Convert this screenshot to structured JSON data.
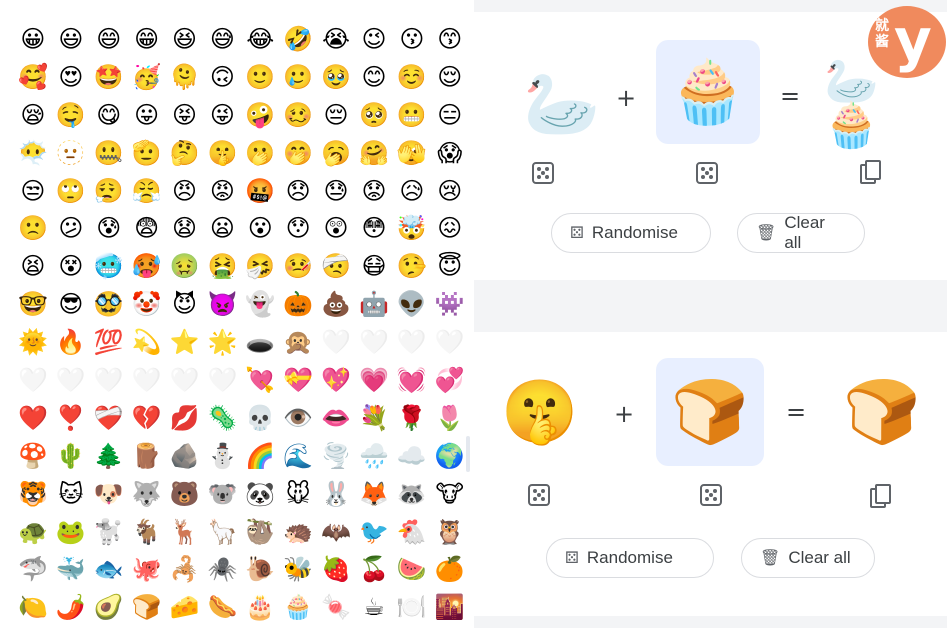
{
  "emoji_grid": [
    [
      "😀",
      "😃",
      "😄",
      "😁",
      "😆",
      "😅",
      "😂",
      "🤣",
      "😭",
      "😉",
      "😗",
      "😙"
    ],
    [
      "🥰",
      "😍",
      "🤩",
      "🥳",
      "🫠",
      "🙃",
      "🙂",
      "🥲",
      "🥹",
      "😊",
      "☺️",
      "😌"
    ],
    [
      "😪",
      "🤤",
      "😋",
      "😛",
      "😝",
      "😜",
      "🤪",
      "🥴",
      "😔",
      "🥺",
      "😬",
      "😑"
    ],
    [
      "😶‍🌫️",
      "🫥",
      "🤐",
      "🫡",
      "🤔",
      "🤫",
      "🫢",
      "🤭",
      "🥱",
      "🤗",
      "🫣",
      "😱"
    ],
    [
      "😒",
      "🙄",
      "😮‍💨",
      "😤",
      "😠",
      "😡",
      "🤬",
      "😞",
      "😓",
      "😟",
      "😥",
      "😢"
    ],
    [
      "🙁",
      "😕",
      "😰",
      "😨",
      "😧",
      "😦",
      "😮",
      "😯",
      "😲",
      "😳",
      "🤯",
      "😖"
    ],
    [
      "😫",
      "😵",
      "🥶",
      "🥵",
      "🤢",
      "🤮",
      "🤧",
      "🤒",
      "🤕",
      "😷",
      "🤥",
      "😇"
    ],
    [
      "🤓",
      "😎",
      "🥸",
      "🤡",
      "😈",
      "👿",
      "👻",
      "🎃",
      "💩",
      "🤖",
      "👽",
      "👾"
    ],
    [
      "🌞",
      "🔥",
      "💯",
      "💫",
      "⭐",
      "🌟",
      "🕳️",
      "🙊",
      "🤍",
      "🤍",
      "🤍",
      "🤍"
    ],
    [
      "🤍",
      "🤍",
      "🤍",
      "🤍",
      "🤍",
      "🤍",
      "💘",
      "💝",
      "💖",
      "💗",
      "💓",
      "💞"
    ],
    [
      "❤️",
      "❣️",
      "❤️‍🩹",
      "💔",
      "💋",
      "🦠",
      "💀",
      "👁️",
      "👄",
      "💐",
      "🌹",
      "🌷"
    ],
    [
      "🍄",
      "🌵",
      "🌲",
      "🪵",
      "🪨",
      "⛄",
      "🌈",
      "🌊",
      "🌪️",
      "🌧️",
      "☁️",
      "🌍"
    ],
    [
      "🐯",
      "🐱",
      "🐶",
      "🐺",
      "🐻",
      "🐨",
      "🐼",
      "🐭",
      "🐰",
      "🦊",
      "🦝",
      "🐮"
    ],
    [
      "🐢",
      "🐸",
      "🐩",
      "🐐",
      "🦌",
      "🦙",
      "🦥",
      "🦔",
      "🦇",
      "🐦",
      "🐔",
      "🦉"
    ],
    [
      "🦈",
      "🐳",
      "🐟",
      "🐙",
      "🦂",
      "🕷️",
      "🐌",
      "🐝",
      "🍓",
      "🍒",
      "🍉",
      "🍊"
    ],
    [
      "🍋",
      "🌶️",
      "🥑",
      "🍞",
      "🧀",
      "🌭",
      "🎂",
      "🧁",
      "🍬",
      "☕",
      "🍽️",
      "🌇"
    ]
  ],
  "faded_cells": [
    "8.8",
    "8.9",
    "8.10",
    "8.11",
    "9.0",
    "9.1",
    "9.2",
    "9.3",
    "9.4",
    "9.5"
  ],
  "mixer_top": {
    "left_emoji": "🦢",
    "right_emoji": "🧁",
    "result_emoji": "🦢🧁",
    "plus": "+",
    "equals": "=",
    "randomise_label": "Randomise",
    "clear_label": "Clear all"
  },
  "mixer_bottom": {
    "left_emoji": "🤫",
    "right_emoji": "🍞",
    "result_emoji": "🍞",
    "plus": "+",
    "equals": "=",
    "randomise_label": "Randomise",
    "clear_label": "Clear all"
  },
  "watermark": {
    "chars": [
      "就",
      "酱"
    ],
    "letter": "y",
    "color": "#f08a5d"
  },
  "colors": {
    "selected_slot": "#e8efff",
    "panel_bg": "#f3f4f6",
    "border": "#dadce0"
  }
}
